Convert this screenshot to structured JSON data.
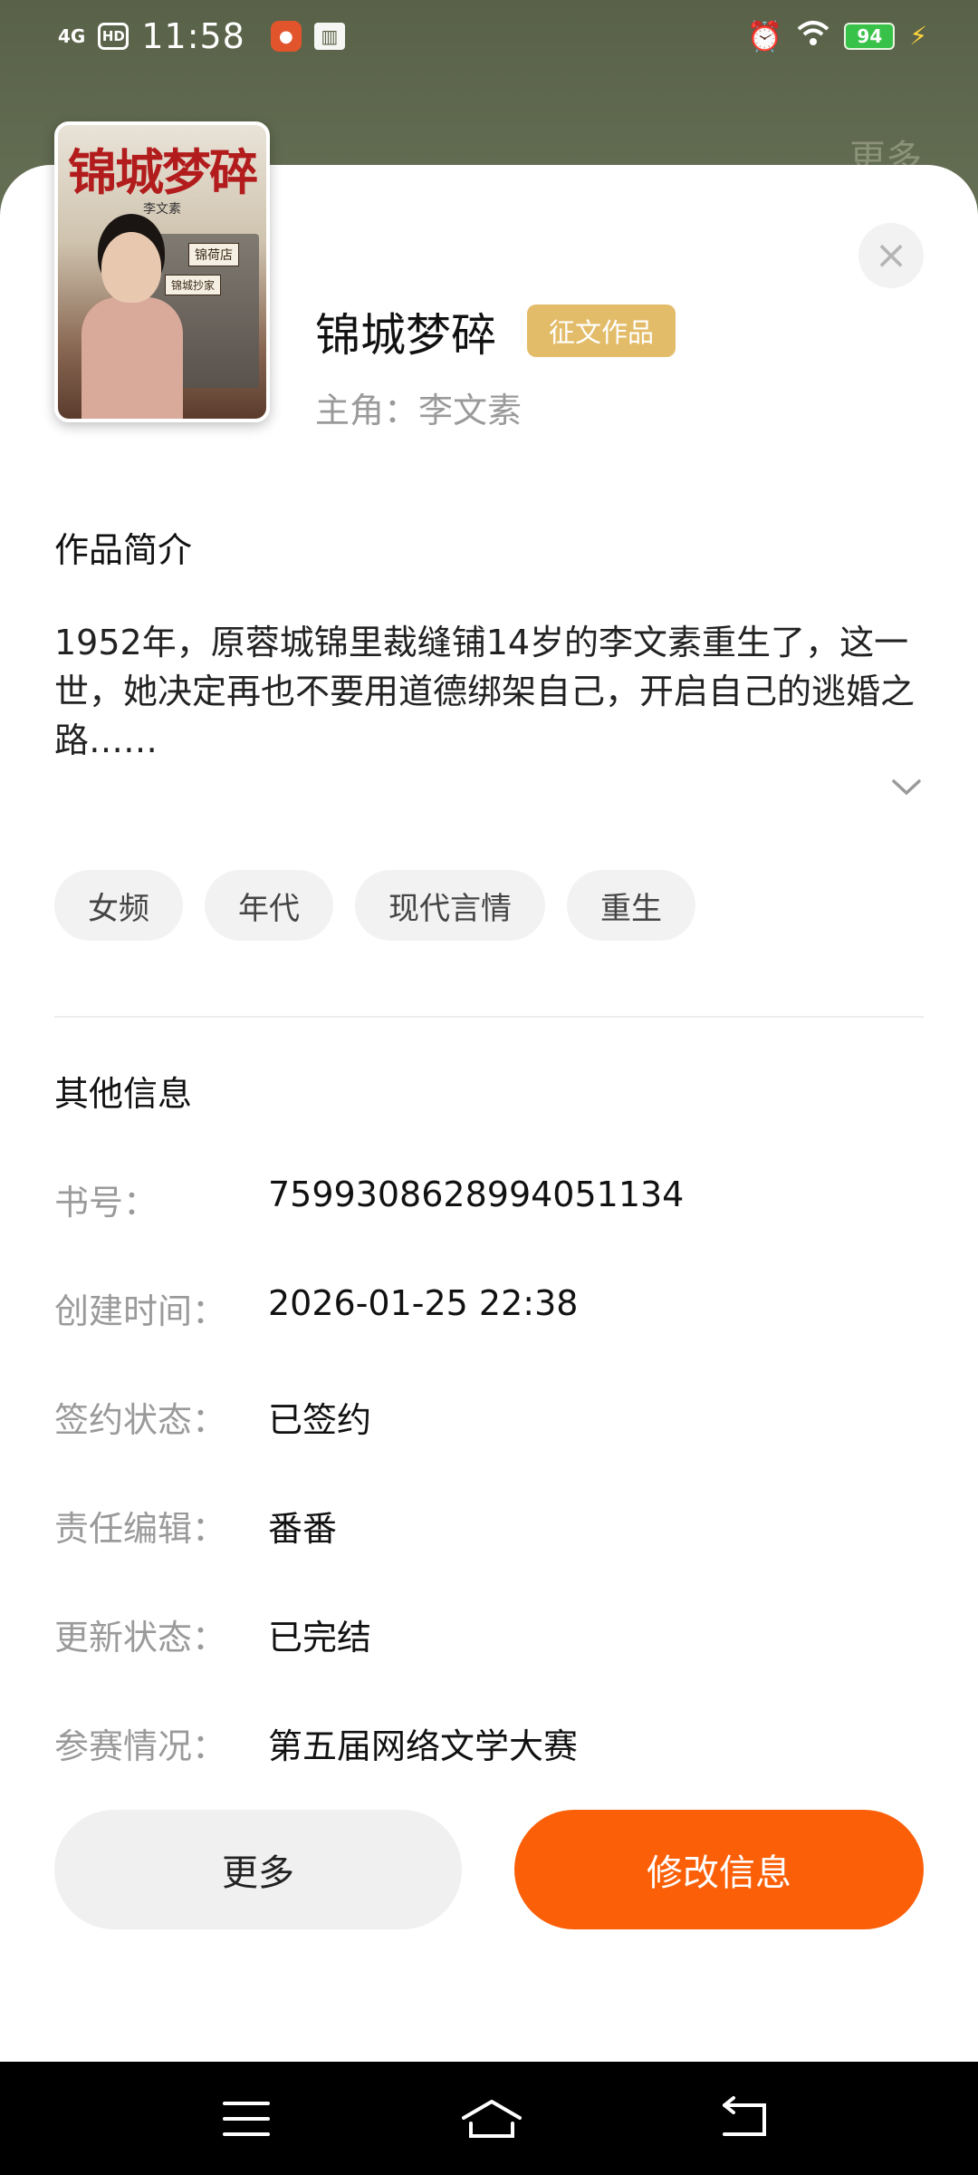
{
  "status_bar": {
    "network": "4G",
    "hd": "HD",
    "time": "11:58",
    "battery": "94",
    "colors": {
      "battery": "#39c24a",
      "charging": "#ffd53b"
    }
  },
  "background": {
    "more_label": "更多"
  },
  "book": {
    "cover_title": "锦城梦碎",
    "cover_author": "李文素",
    "cover_sign_1": "锦荷店",
    "cover_sign_2": "锦城抄家",
    "title": "锦城梦碎",
    "badge": "征文作品",
    "protagonist": "主角：李文素"
  },
  "synopsis": {
    "heading": "作品简介",
    "text": "1952年，原蓉城锦里裁缝铺14岁的李文素重生了，这一世，她决定再也不要用道德绑架自己，开启自己的逃婚之路……"
  },
  "tags": [
    "女频",
    "年代",
    "现代言情",
    "重生"
  ],
  "other_info": {
    "heading": "其他信息",
    "rows": [
      {
        "label": "书号：",
        "value": "7599308628994051134"
      },
      {
        "label": "创建时间：",
        "value": "2026-01-25 22:38"
      },
      {
        "label": "签约状态：",
        "value": "已签约"
      },
      {
        "label": "责任编辑：",
        "value": "番番"
      },
      {
        "label": "更新状态：",
        "value": "已完结"
      },
      {
        "label": "参赛情况：",
        "value": "第五届网络文学大赛"
      }
    ]
  },
  "actions": {
    "more": "更多",
    "edit": "修改信息",
    "colors": {
      "primary": "#fb5f08",
      "secondary": "#f0f0f0"
    }
  }
}
